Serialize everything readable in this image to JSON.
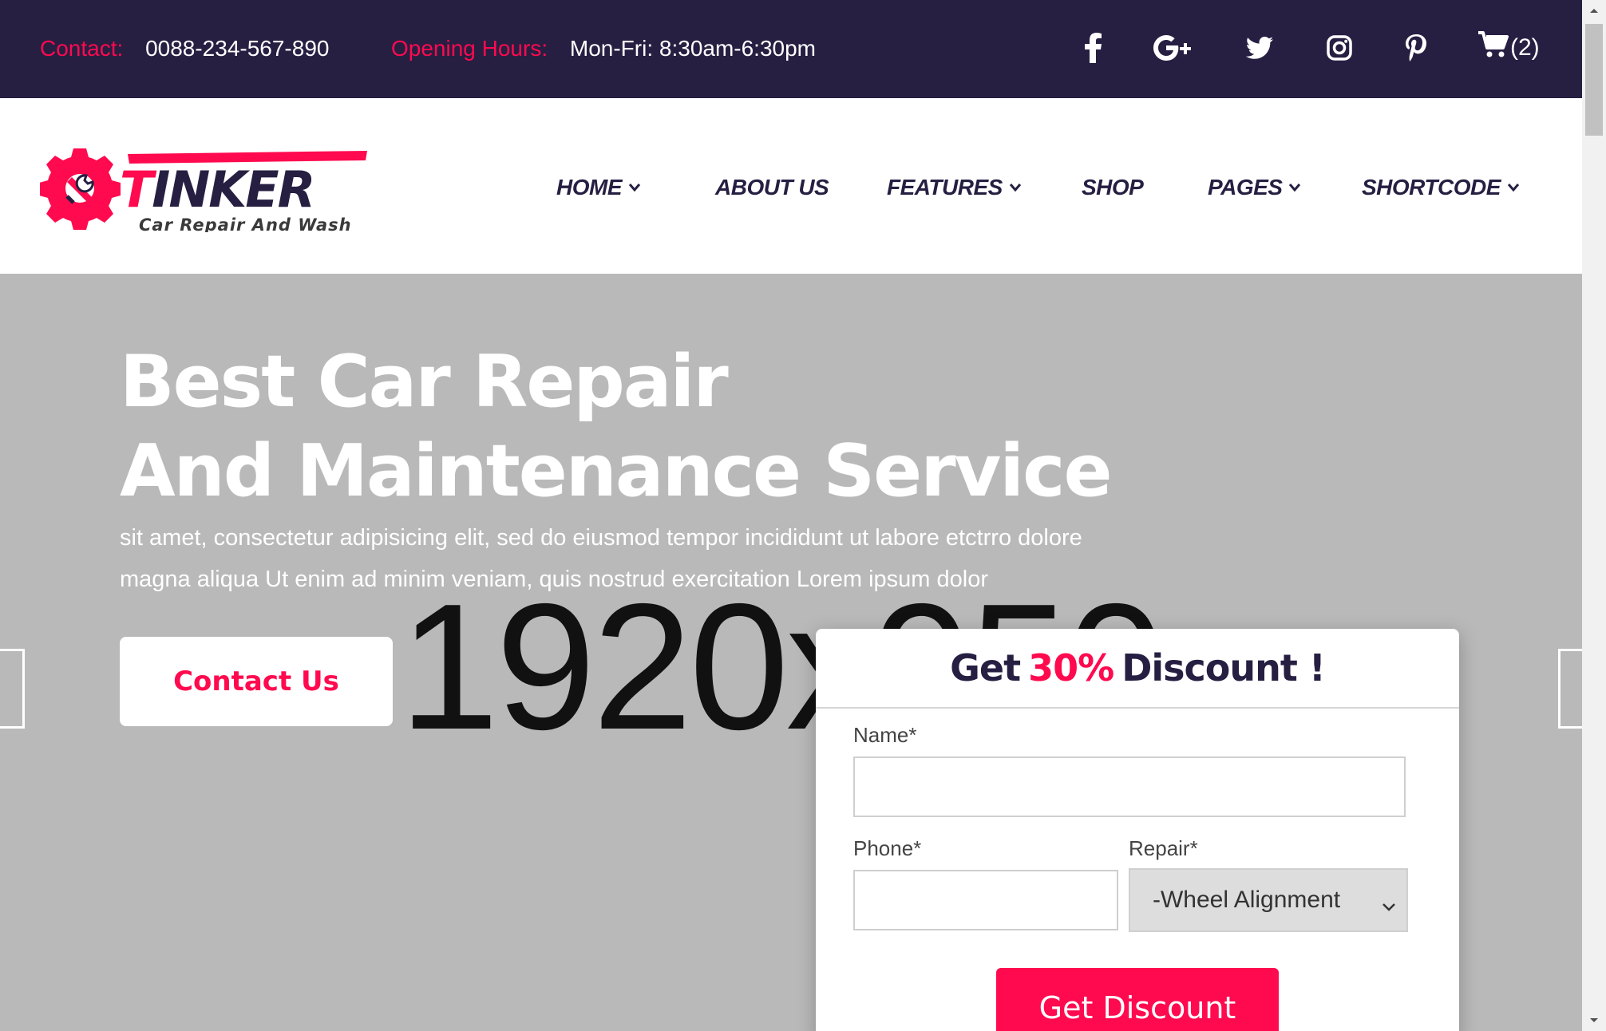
{
  "topbar": {
    "contact_label": "Contact:",
    "contact_value": "0088-234-567-890",
    "hours_label": "Opening Hours:",
    "hours_value": "Mon-Fri: 8:30am-6:30pm",
    "social_icons": [
      "facebook-icon",
      "google-plus-icon",
      "twitter-icon",
      "instagram-icon",
      "pinterest-icon"
    ],
    "cart_count": "(2)"
  },
  "logo": {
    "brand": "TINKER",
    "tagline": "Car Repair And Wash"
  },
  "nav": {
    "items": [
      {
        "label": "HOME",
        "has_dropdown": true
      },
      {
        "label": "ABOUT US",
        "has_dropdown": false
      },
      {
        "label": "FEATURES",
        "has_dropdown": true
      },
      {
        "label": "SHOP",
        "has_dropdown": false
      },
      {
        "label": "PAGES",
        "has_dropdown": true
      },
      {
        "label": "SHORTCODE",
        "has_dropdown": true
      }
    ]
  },
  "hero": {
    "title_line1": "Best Car Repair",
    "title_line2": "And Maintenance Service",
    "subtitle_line1": "sit amet, consectetur adipisicing elit, sed do eiusmod tempor incididunt ut labore etctrro dolore",
    "subtitle_line2": "magna aliqua Ut enim ad minim veniam, quis nostrud exercitation Lorem ipsum dolor",
    "button_label": "Contact Us",
    "placeholder_text": "1920x950"
  },
  "discount_form": {
    "title_prefix": "Get",
    "title_accent": "30%",
    "title_suffix": "Discount !",
    "name_label": "Name*",
    "phone_label": "Phone*",
    "repair_label": "Repair*",
    "repair_selected": "-Wheel Alignment",
    "submit_label": "Get Discount"
  },
  "colors": {
    "brand_dark": "#261f42",
    "accent": "#ff0a4f",
    "hero_bg": "#b9b9b9"
  }
}
